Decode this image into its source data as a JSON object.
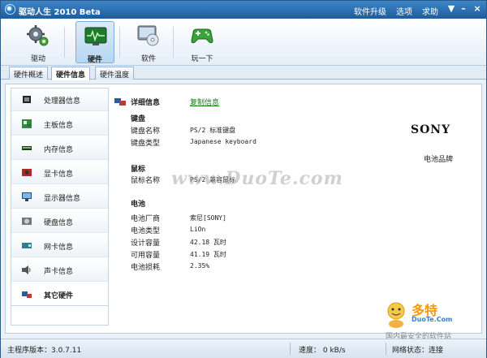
{
  "titlebar": {
    "title": "驱动人生 2010 Beta",
    "menu": [
      "软件升级",
      "选项",
      "求助"
    ],
    "controls": [
      "▼",
      "–",
      "×"
    ]
  },
  "toolbar": {
    "items": [
      {
        "label": "驱动",
        "icon": "gears-icon",
        "active": false
      },
      {
        "label": "硬件",
        "icon": "hardware-monitor-icon",
        "active": true
      },
      {
        "label": "软件",
        "icon": "software-disc-icon",
        "active": false
      },
      {
        "label": "玩一下",
        "icon": "gamepad-icon",
        "active": false
      }
    ]
  },
  "tabs": [
    "硬件概述",
    "硬件信息",
    "硬件温度"
  ],
  "sidebar": {
    "items": [
      {
        "label": "处理器信息",
        "icon": "cpu-icon"
      },
      {
        "label": "主板信息",
        "icon": "motherboard-icon"
      },
      {
        "label": "内存信息",
        "icon": "memory-icon"
      },
      {
        "label": "显卡信息",
        "icon": "graphics-card-icon"
      },
      {
        "label": "显示器信息",
        "icon": "monitor-icon"
      },
      {
        "label": "硬盘信息",
        "icon": "hard-disk-icon"
      },
      {
        "label": "网卡信息",
        "icon": "network-card-icon"
      },
      {
        "label": "声卡信息",
        "icon": "sound-card-icon"
      },
      {
        "label": "其它硬件",
        "icon": "other-hardware-icon"
      }
    ],
    "active_index": 8
  },
  "detail": {
    "title": "详细信息",
    "copy_link": "复制信息",
    "keyboard": {
      "section": "键盘",
      "rows": [
        {
          "key": "键盘名称",
          "value": "PS/2 标准键盘"
        },
        {
          "key": "键盘类型",
          "value": "Japanese keyboard"
        }
      ]
    },
    "mouse": {
      "section": "鼠标",
      "rows": [
        {
          "key": "鼠标名称",
          "value": "PS/2 兼容鼠标"
        }
      ]
    },
    "battery": {
      "section": "电池",
      "rows": [
        {
          "key": "电池厂商",
          "value": "索尼[SONY]"
        },
        {
          "key": "电池类型",
          "value": "LiOn"
        },
        {
          "key": "设计容量",
          "value": "42.18 瓦时"
        },
        {
          "key": "可用容量",
          "value": "41.19 瓦时"
        },
        {
          "key": "电池损耗",
          "value": "2.35%"
        }
      ]
    },
    "brand": {
      "logo": "SONY",
      "caption": "电池品牌"
    }
  },
  "watermark": "www.DuoTe.com",
  "statusbar": {
    "version": "主程序版本：3.0.7.11",
    "speed": "速度： 0 kB/s",
    "network": "网络状态：连接"
  },
  "corner_logo": {
    "line1": "多特",
    "line2": "DuoTe.Com",
    "line3": "国内最安全的软件站"
  },
  "colors": {
    "titlebar": "#1e5c9b",
    "accent": "#7faed8",
    "link": "#157a15"
  }
}
